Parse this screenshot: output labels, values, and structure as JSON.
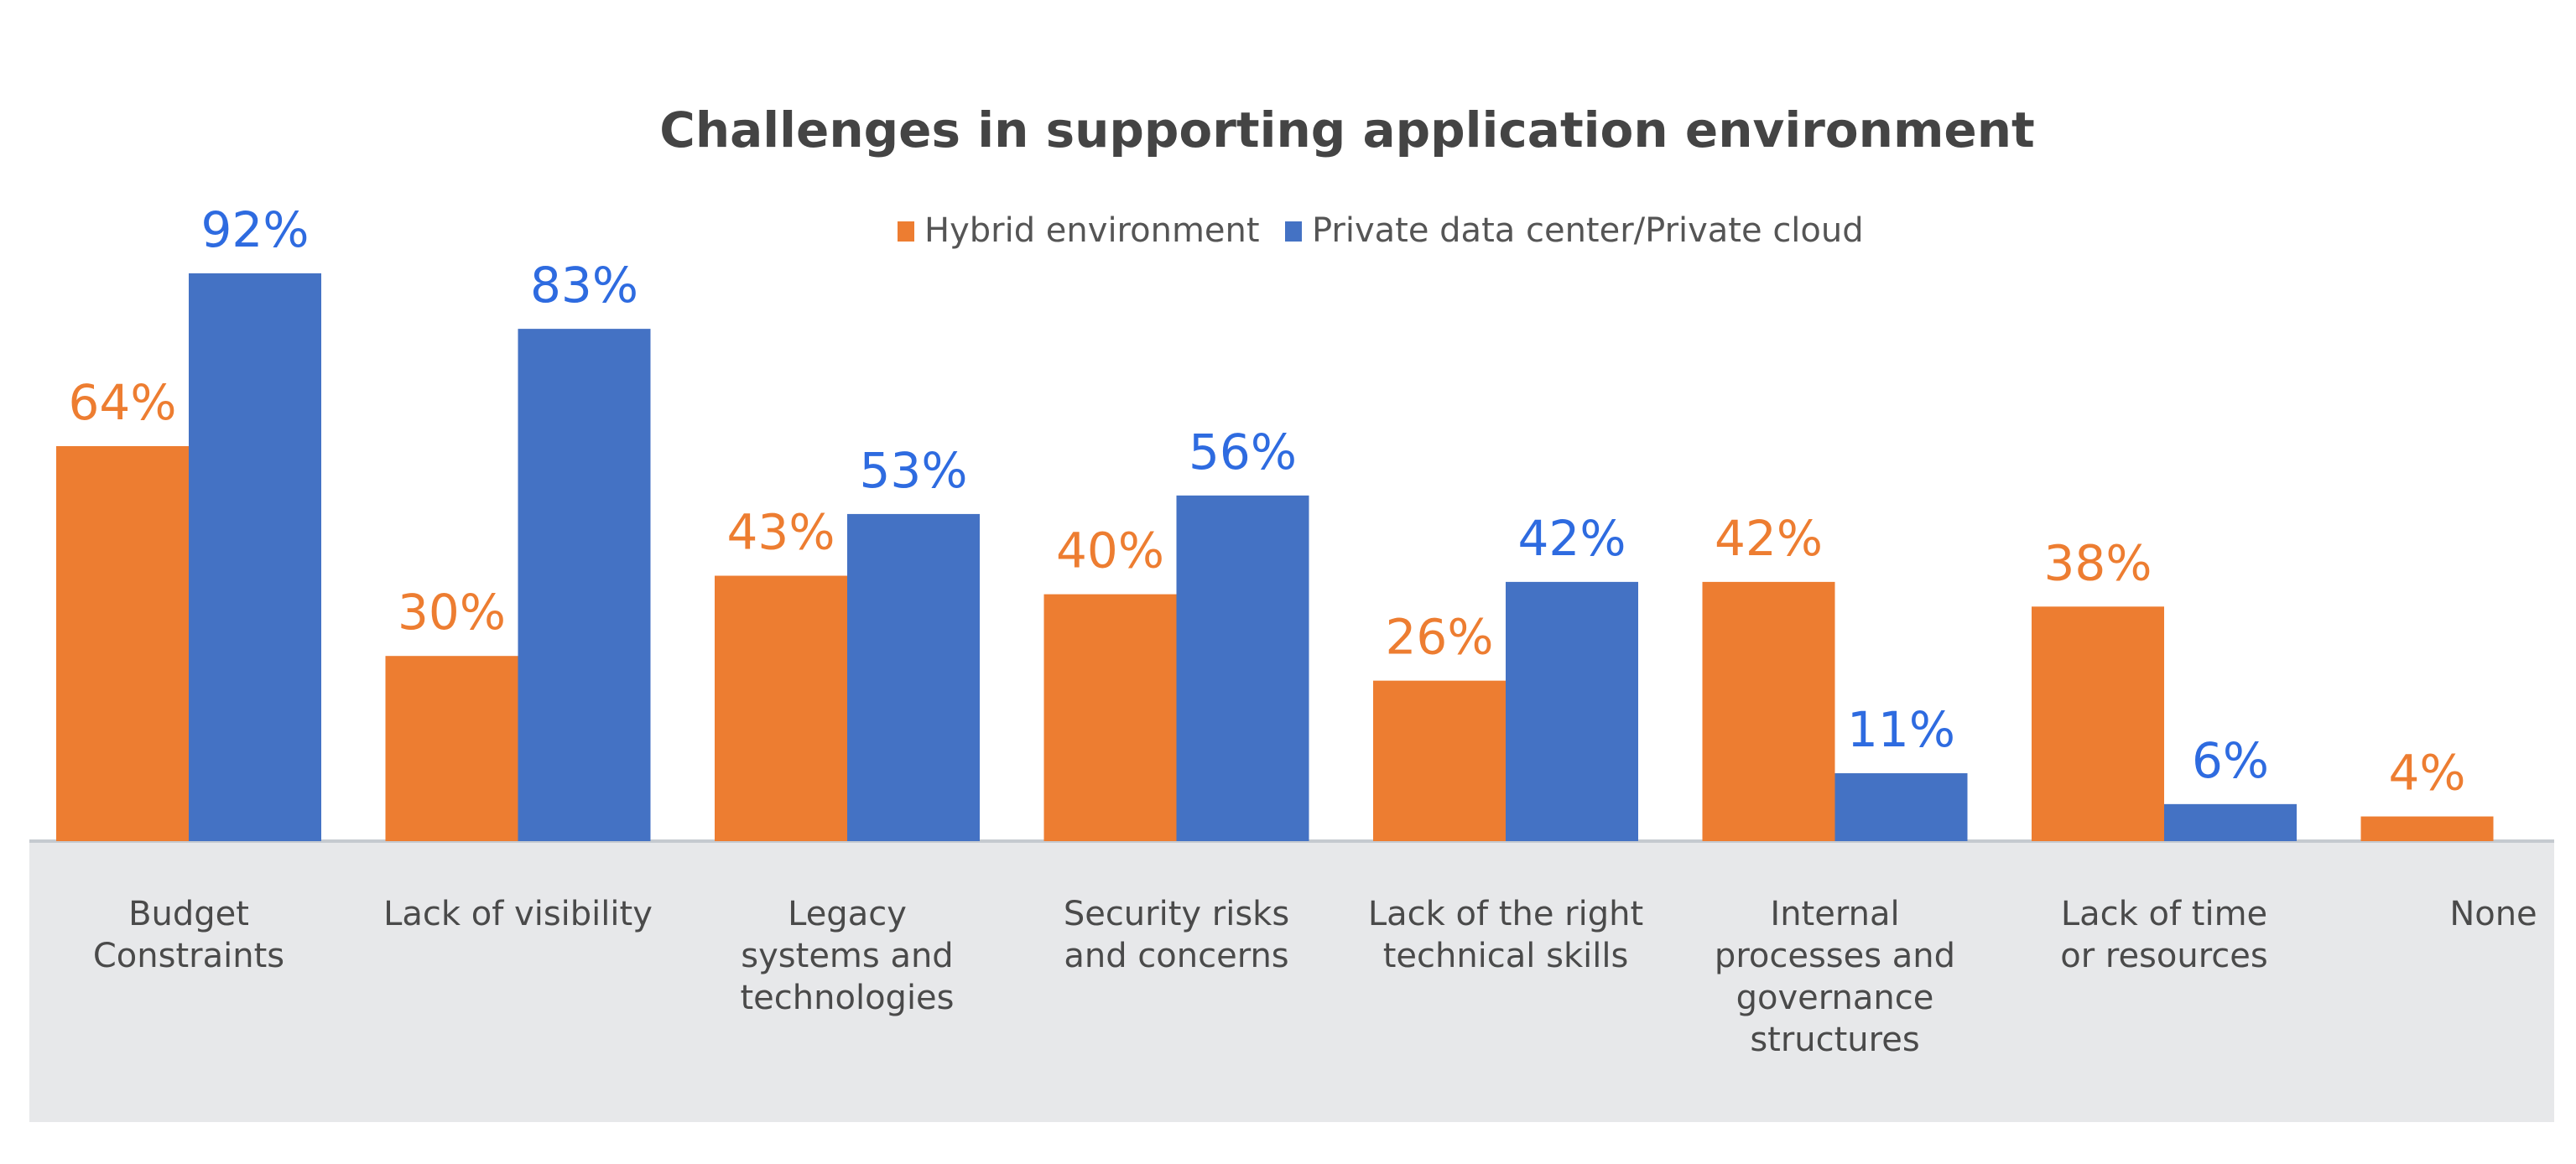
{
  "chart_data": {
    "type": "bar",
    "title": "Challenges in supporting application environment",
    "xlabel": "",
    "ylabel": "",
    "ylim": [
      0,
      100
    ],
    "grid": false,
    "legend_position": "top-center",
    "value_format": "percent",
    "categories": [
      "Budget Constraints",
      "Lack of visibility",
      "Legacy systems and technologies",
      "Security risks and concerns",
      "Lack of the right technical skills",
      "Internal processes and governance structures",
      "Lack of time or resources",
      "None"
    ],
    "category_lines": [
      [
        "Budget",
        "Constraints"
      ],
      [
        "Lack of visibility"
      ],
      [
        "Legacy",
        "systems and",
        "technologies"
      ],
      [
        "Security risks",
        "and concerns"
      ],
      [
        "Lack of the right",
        "technical skills"
      ],
      [
        "Internal",
        "processes and",
        "governance",
        "structures"
      ],
      [
        "Lack of time",
        "or resources"
      ],
      [
        "None"
      ]
    ],
    "series": [
      {
        "name": "Hybrid environment",
        "color": "#ED7D31",
        "label_color": "#ED7D31",
        "values": [
          64,
          30,
          43,
          40,
          26,
          42,
          38,
          4
        ]
      },
      {
        "name": "Private data center/Private cloud",
        "color": "#4472C4",
        "label_color": "#2E6BE0",
        "values": [
          92,
          83,
          53,
          56,
          42,
          11,
          6,
          null
        ]
      }
    ]
  },
  "colors": {
    "axis_panel": "#E7E8EA",
    "axis_line": "#C5CAD0",
    "title": "#444444",
    "text": "#4a4a4a"
  }
}
